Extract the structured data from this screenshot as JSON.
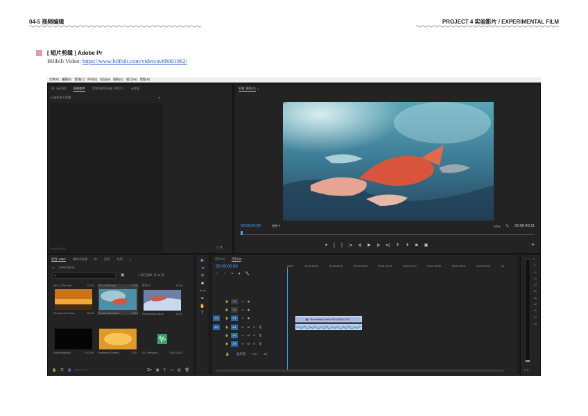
{
  "doc": {
    "left_header": "04-5 视频编辑",
    "right_header": "PROJECT 4  实验影片 / EXPERIMENTAL FILM",
    "section_title": "[ 短片剪辑 ] Adobe Pr",
    "video_prefix": "Bilibili Video: ",
    "video_url": "https://www.bilibili.com/video/av69001062/",
    "accent_color": "#e89aa8"
  },
  "app": {
    "menu": [
      "文件(F)",
      "编辑(E)",
      "剪辑(C)",
      "序列(S)",
      "标记(M)",
      "图形(G)",
      "窗口(W)",
      "帮助(H)"
    ],
    "source_panel": {
      "tabs": [
        "源: (无剪辑)",
        "效果控件",
        "音频剪辑混合器: 序列 01",
        "元数据"
      ],
      "active_tab": "效果控件",
      "header_label": "已选中多个剪辑",
      "expand_icon": "▸",
      "timecode": "00:00:00:00"
    },
    "program_panel": {
      "tab": "节目: 序列 01",
      "menu_icon": "≡",
      "timecode_current": "00:00:00:00",
      "fit": "适合",
      "resolution": "1/2",
      "timecode_total": "00:00:46:11"
    },
    "project_panel": {
      "tabs": [
        "项目: water",
        "媒体浏览器",
        "库",
        "信息",
        "效果"
      ],
      "active_tab": "项目: water",
      "more": "»",
      "project_file": "water.prproj",
      "search_placeholder": "",
      "selection_info": "1 项已选择, 共 11 项",
      "items": [
        {
          "name": "IMG_2158.mp4",
          "duration": "25;28",
          "top": true
        },
        {
          "name": "IMG_2155.mp4",
          "duration": "20;23",
          "top": true
        },
        {
          "name": "序列 01",
          "duration": "46:08",
          "top": true
        },
        {
          "name": "RenderedContent...",
          "duration": "56;18"
        },
        {
          "name": "RenderedContent...",
          "duration": "46;13"
        },
        {
          "name": "RenderedContent...",
          "duration": "25;23"
        },
        {
          "name": "Videoplayback...",
          "duration": "4:43:09"
        },
        {
          "name": "RenderedContent...",
          "duration": "20;17"
        },
        {
          "name": "01. Sleepless...",
          "duration": "1:04:34102"
        }
      ]
    },
    "timeline_panel": {
      "tabs": [
        "序列 01",
        "序列 03"
      ],
      "active_tab": "序列 03",
      "timecode": "00:00:00:00",
      "ruler": [
        ":00:00",
        "00:00:15:00",
        "00:00:30:00",
        "00:00:45:00",
        "00:01:00:00",
        "00:01:15:00",
        "00:01:30:00",
        "00:01:45:00",
        "00:02:00:00",
        "00"
      ],
      "video_tracks": [
        "V3",
        "V2",
        "V1"
      ],
      "audio_tracks": [
        "A1",
        "A2",
        "A3"
      ],
      "source_v": "V1",
      "source_a": "A1",
      "track_mute": "M",
      "track_solo": "S",
      "video_clip_label": "RenderedContent-00141864-D23",
      "master_label": "主声道",
      "master_value": "0.0"
    },
    "meter": {
      "scale": [
        "0",
        "-6",
        "-12",
        "-18",
        "-24",
        "-30",
        "-36",
        "-42",
        "-48",
        "-54",
        "-dB"
      ],
      "level_fraction": 0.02,
      "solo_buttons": "S  S"
    },
    "colors": {
      "app_bg": "#1e1e1e",
      "panel_bg": "#232323",
      "accent_blue": "#4da3ff",
      "clip_video": "#a7b9e8",
      "clip_audio": "#a6c8ee"
    }
  }
}
